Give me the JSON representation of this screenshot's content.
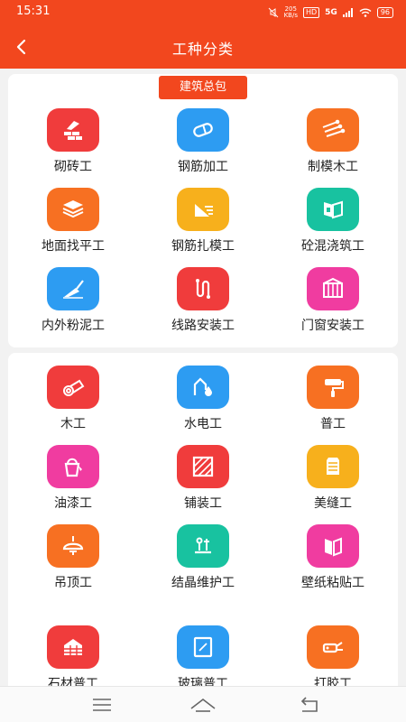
{
  "status": {
    "time": "15:31",
    "net_speed": "205\nKB/s",
    "hd": "HD",
    "signal": "5G",
    "battery": "96"
  },
  "header": {
    "title": "工种分类"
  },
  "sections": [
    {
      "tag": "建筑总包",
      "items": [
        {
          "label": "砌砖工",
          "icon": "bricklaying-icon",
          "color": "#f03c3c"
        },
        {
          "label": "钢筋加工",
          "icon": "rebar-processing-icon",
          "color": "#2d9cf2"
        },
        {
          "label": "制模木工",
          "icon": "formwork-icon",
          "color": "#f77022"
        },
        {
          "label": "地面找平工",
          "icon": "floor-leveling-icon",
          "color": "#f77022"
        },
        {
          "label": "钢筋扎模工",
          "icon": "rebar-tying-icon",
          "color": "#f7b01c"
        },
        {
          "label": "砼混浇筑工",
          "icon": "concrete-pouring-icon",
          "color": "#18c2a0"
        },
        {
          "label": "内外粉泥工",
          "icon": "plastering-icon",
          "color": "#2d9cf2"
        },
        {
          "label": "线路安装工",
          "icon": "wiring-icon",
          "color": "#f03c3c"
        },
        {
          "label": "门窗安装工",
          "icon": "door-window-icon",
          "color": "#f03ca0"
        }
      ]
    },
    {
      "items": [
        {
          "label": "木工",
          "icon": "carpentry-icon",
          "color": "#f03c3c"
        },
        {
          "label": "水电工",
          "icon": "plumbing-electric-icon",
          "color": "#2d9cf2"
        },
        {
          "label": "普工",
          "icon": "paint-roller-icon",
          "color": "#f77022"
        },
        {
          "label": "油漆工",
          "icon": "paint-bucket-icon",
          "color": "#f03ca0"
        },
        {
          "label": "铺装工",
          "icon": "tiling-icon",
          "color": "#f03c3c"
        },
        {
          "label": "美缝工",
          "icon": "grout-icon",
          "color": "#f7b01c"
        },
        {
          "label": "吊顶工",
          "icon": "ceiling-lamp-icon",
          "color": "#f77022"
        },
        {
          "label": "结晶维护工",
          "icon": "crystal-care-icon",
          "color": "#18c2a0"
        },
        {
          "label": "壁纸粘贴工",
          "icon": "wallpaper-icon",
          "color": "#f03ca0"
        }
      ]
    },
    {
      "items": [
        {
          "label": "石材普工",
          "icon": "stone-icon",
          "color": "#f03c3c"
        },
        {
          "label": "玻璃普工",
          "icon": "glass-icon",
          "color": "#2d9cf2"
        },
        {
          "label": "打胶工",
          "icon": "caulking-icon",
          "color": "#f77022"
        }
      ]
    }
  ],
  "nav": {
    "menu": "menu-icon",
    "home": "home-icon",
    "back": "back-icon"
  }
}
